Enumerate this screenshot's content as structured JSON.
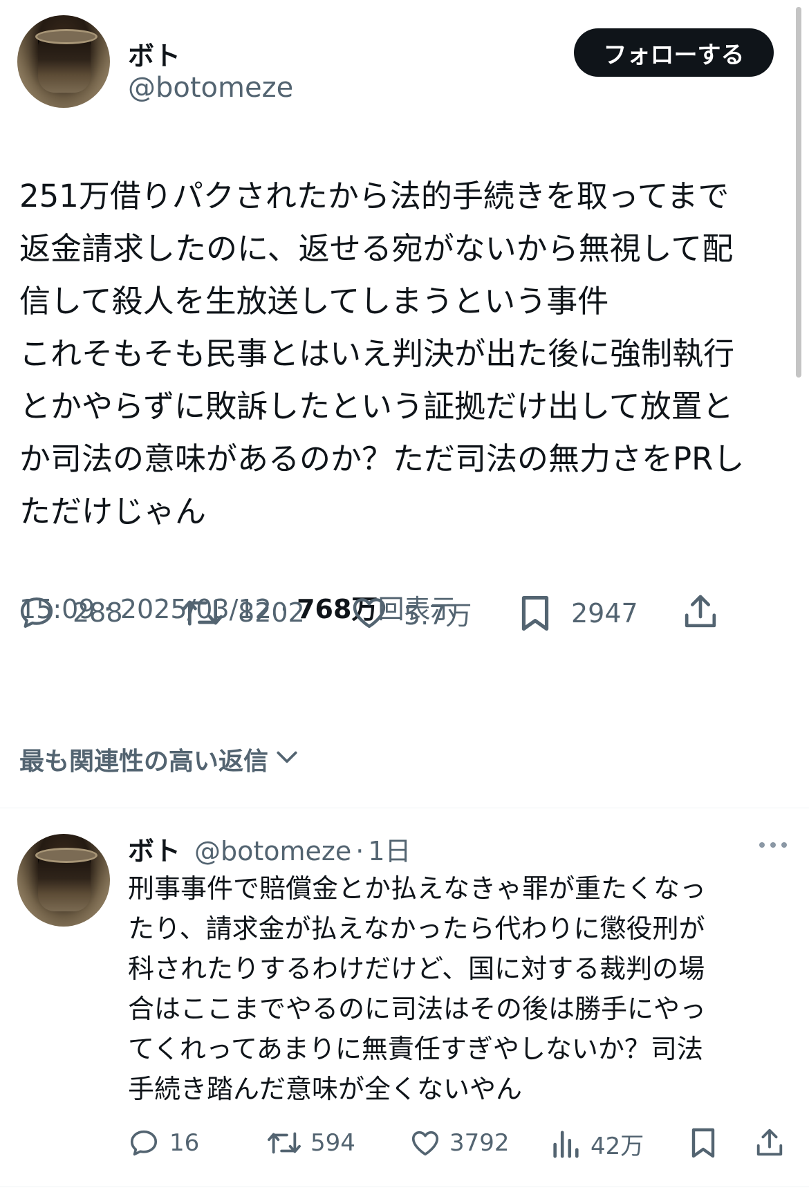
{
  "main_tweet": {
    "author_name": "ボト",
    "author_handle": "@botomeze",
    "follow_label": "フォローする",
    "text_lines": [
      "251万借りパクされたから法的手続きを取ってまで",
      "返金請求したのに、返せる宛がないから無視して配",
      "信して殺人を生放送してしまうという事件",
      "これそもそも民事とはいえ判決が出た後に強制執行",
      "とかやらずに敗訴したという証拠だけ出して放置と",
      "か司法の意味があるのか？ただ司法の無力さをPRし",
      "ただけじゃん"
    ],
    "time": "15:09",
    "date": "2025/03/12",
    "sep": "·",
    "views_value": "768万",
    "views_label": "回表示",
    "replies": "288",
    "retweets": "8202",
    "likes": "5.7万",
    "bookmarks": "2947"
  },
  "replies_sort_label": "最も関連性の高い返信",
  "reply": {
    "author_name": "ボト",
    "author_handle": "@botomeze",
    "sep": "·",
    "age": "1日",
    "text_lines": [
      "刑事事件で賠償金とか払えなきゃ罪が重たくなっ",
      "たり、請求金が払えなかったら代わりに懲役刑が",
      "科されたりするわけだけど、国に対する裁判の場",
      "合はここまでやるのに司法はその後は勝手にやっ",
      "てくれってあまりに無責任すぎやしないか？司法",
      "手続き踏んだ意味が全くないやん"
    ],
    "replies": "16",
    "retweets": "594",
    "likes": "3792",
    "views": "42万"
  },
  "colors": {
    "text": "#0f1419",
    "secondary": "#536471",
    "button_bg": "#0f1419"
  }
}
